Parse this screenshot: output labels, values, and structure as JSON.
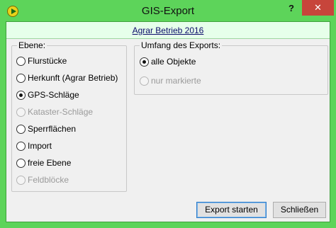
{
  "window": {
    "title": "GIS-Export",
    "help": "?",
    "close": "✕"
  },
  "header": {
    "link": "Agrar Betrieb 2016"
  },
  "ebene": {
    "title": "Ebene:",
    "options": [
      {
        "label": "Flurstücke",
        "checked": false,
        "disabled": false
      },
      {
        "label": "Herkunft (Agrar Betrieb)",
        "checked": false,
        "disabled": false
      },
      {
        "label": "GPS-Schläge",
        "checked": true,
        "disabled": false
      },
      {
        "label": "Kataster-Schläge",
        "checked": false,
        "disabled": true
      },
      {
        "label": "Sperrflächen",
        "checked": false,
        "disabled": false
      },
      {
        "label": "Import",
        "checked": false,
        "disabled": false
      },
      {
        "label": "freie Ebene",
        "checked": false,
        "disabled": false
      },
      {
        "label": "Feldblöcke",
        "checked": false,
        "disabled": true
      }
    ]
  },
  "umfang": {
    "title": "Umfang des Exports:",
    "options": [
      {
        "label": "alle Objekte",
        "checked": true,
        "disabled": false
      },
      {
        "label": "nur markierte",
        "checked": false,
        "disabled": true
      }
    ]
  },
  "buttons": {
    "export": "Export starten",
    "close": "Schließen"
  }
}
